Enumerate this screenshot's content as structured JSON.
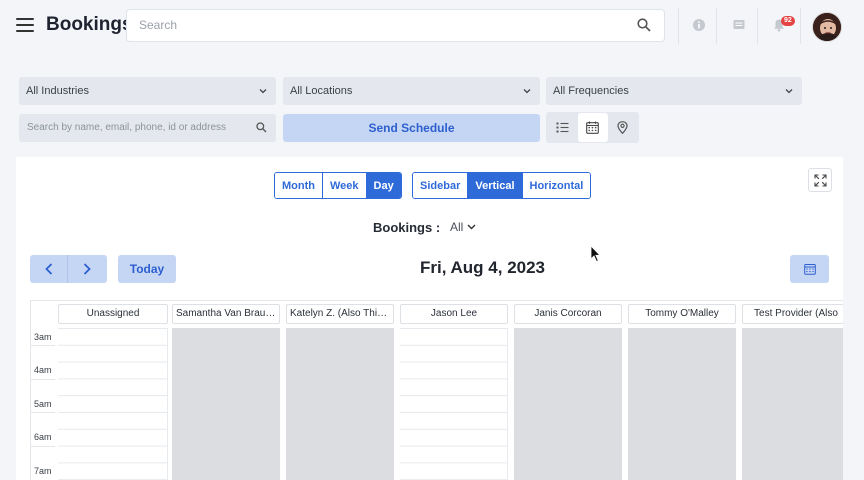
{
  "header": {
    "title": "Bookings",
    "search_placeholder": "Search",
    "notification_count": "92"
  },
  "filters": {
    "industry": "All Industries",
    "location": "All Locations",
    "frequency": "All Frequencies",
    "search_placeholder": "Search by name, email, phone, id or address",
    "send_schedule": "Send Schedule"
  },
  "calendar": {
    "range_tabs": [
      "Month",
      "Week",
      "Day"
    ],
    "active_range": "Day",
    "layout_tabs": [
      "Sidebar",
      "Vertical",
      "Horizontal"
    ],
    "active_layout": "Vertical",
    "bookings_label": "Bookings :",
    "bookings_filter": "All",
    "today_label": "Today",
    "date_title": "Fri, Aug 4, 2023",
    "hours": [
      "3am",
      "4am",
      "5am",
      "6am",
      "7am"
    ],
    "columns": [
      {
        "name": "Unassigned",
        "state": "open"
      },
      {
        "name": "Samantha Van Braun ...",
        "state": "blocked"
      },
      {
        "name": "Katelyn Z. (Also This ...",
        "state": "blocked"
      },
      {
        "name": "Jason Lee",
        "state": "open"
      },
      {
        "name": "Janis Corcoran",
        "state": "blocked"
      },
      {
        "name": "Tommy O'Malley",
        "state": "blocked"
      },
      {
        "name": "Test Provider (Also",
        "state": "blocked"
      }
    ]
  },
  "colors": {
    "accent": "#2f6ad9",
    "accent_light": "#c5d6f5",
    "blocked": "#dcdde1",
    "badge": "#e54343"
  }
}
